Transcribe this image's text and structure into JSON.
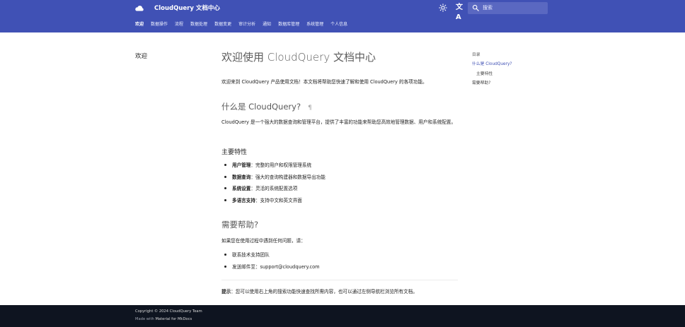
{
  "header": {
    "site_title": "CloudQuery 文档中心",
    "search_placeholder": "搜索",
    "lang_glyph": "文A",
    "icons": {
      "logo": "cloud-icon",
      "palette": "brightness-icon",
      "language": "translate-icon",
      "search": "search-icon"
    }
  },
  "tabs": [
    {
      "label": "欢迎",
      "active": true
    },
    {
      "label": "数据操作"
    },
    {
      "label": "流程"
    },
    {
      "label": "数据处理"
    },
    {
      "label": "数据变更"
    },
    {
      "label": "审计分析"
    },
    {
      "label": "通知"
    },
    {
      "label": "数据库管理"
    },
    {
      "label": "系统管理"
    },
    {
      "label": "个人信息"
    }
  ],
  "sidebar": {
    "title": "欢迎"
  },
  "content": {
    "title": "欢迎使用 CloudQuery 文档中心",
    "intro": "欢迎来到 CloudQuery 产品使用文档！本文档将帮助您快速了解和使用 CloudQuery 的各项功能。",
    "section1_title": "什么是 CloudQuery?",
    "section1_pilcrow": "¶",
    "section1_para": "CloudQuery 是一个强大的数据查询和管理平台，提供了丰富的功能来帮助您高效地管理数据、用户和系统配置。",
    "features_title": "主要特性",
    "features": [
      {
        "bold": "用户管理",
        "text": "：完整的用户和权限管理系统"
      },
      {
        "bold": "数据查询",
        "text": "：强大的查询构建器和数据导出功能"
      },
      {
        "bold": "系统设置",
        "text": "：灵活的系统配置选项"
      },
      {
        "bold": "多语言支持",
        "text": "：支持中文和英文界面"
      }
    ],
    "help_title": "需要帮助?",
    "help_para": "如果您在使用过程中遇到任何问题，请：",
    "help_items": [
      "联系技术支持团队",
      "发送邮件至：support@cloudquery.com"
    ],
    "tip_label": "提示",
    "tip_text": "：您可以使用右上角的搜索功能快速查找所需内容，也可以通过左侧导航栏浏览所有文档。"
  },
  "toc": {
    "title": "目录",
    "items": [
      "什么是 CloudQuery?",
      "主要特性",
      "需要帮助?"
    ]
  },
  "footer": {
    "copyright": "Copyright © 2024 CloudQuery Team",
    "made_with_prefix": "Made with",
    "made_with_link": "Material for MkDocs"
  },
  "colors": {
    "header_bg": "#4051b5",
    "footer_bg": "#0e1420",
    "link": "#4051b5"
  }
}
